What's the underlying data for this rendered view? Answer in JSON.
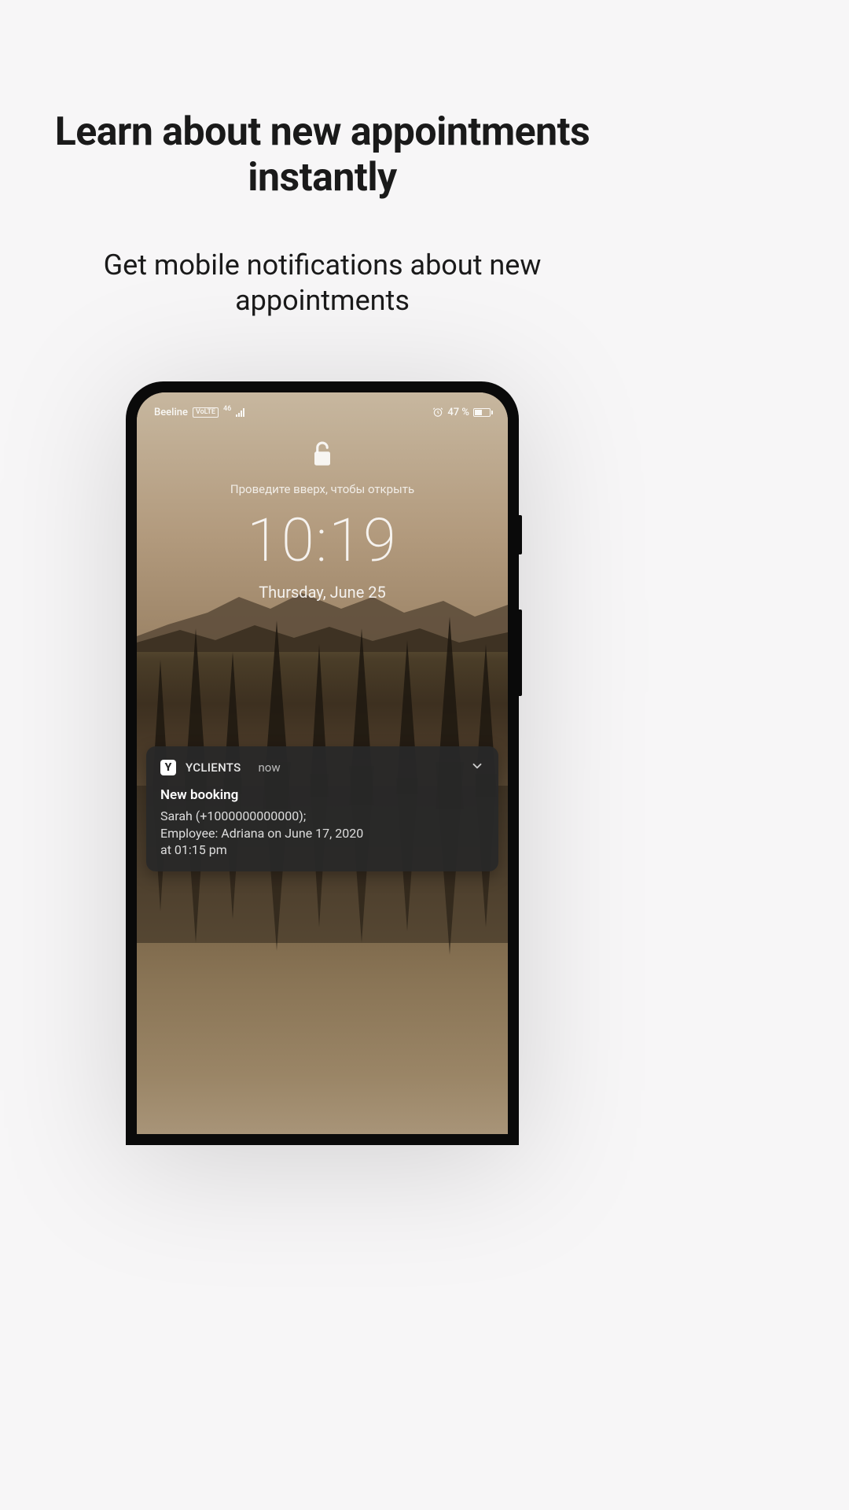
{
  "promo": {
    "heading": "Learn about new appointments instantly",
    "subheading": "Get mobile notifications about new appointments"
  },
  "phone": {
    "status_bar": {
      "carrier": "Beeline",
      "volte_badge": "VoLTE",
      "network_gen": "46",
      "alarm_icon": "alarm-icon",
      "battery_percent": "47 %"
    },
    "lockscreen": {
      "unlock_hint": "Проведите вверх, чтобы открыть",
      "time": "10:19",
      "date": "Thursday, June 25"
    },
    "notification": {
      "app_icon_letter": "Y",
      "app_name": "YCLIENTS",
      "when": "now",
      "title": "New booking",
      "line1": "Sarah (+1000000000000);",
      "line2": "Employee: Adriana on June 17, 2020",
      "line3": "at 01:15 pm"
    }
  }
}
